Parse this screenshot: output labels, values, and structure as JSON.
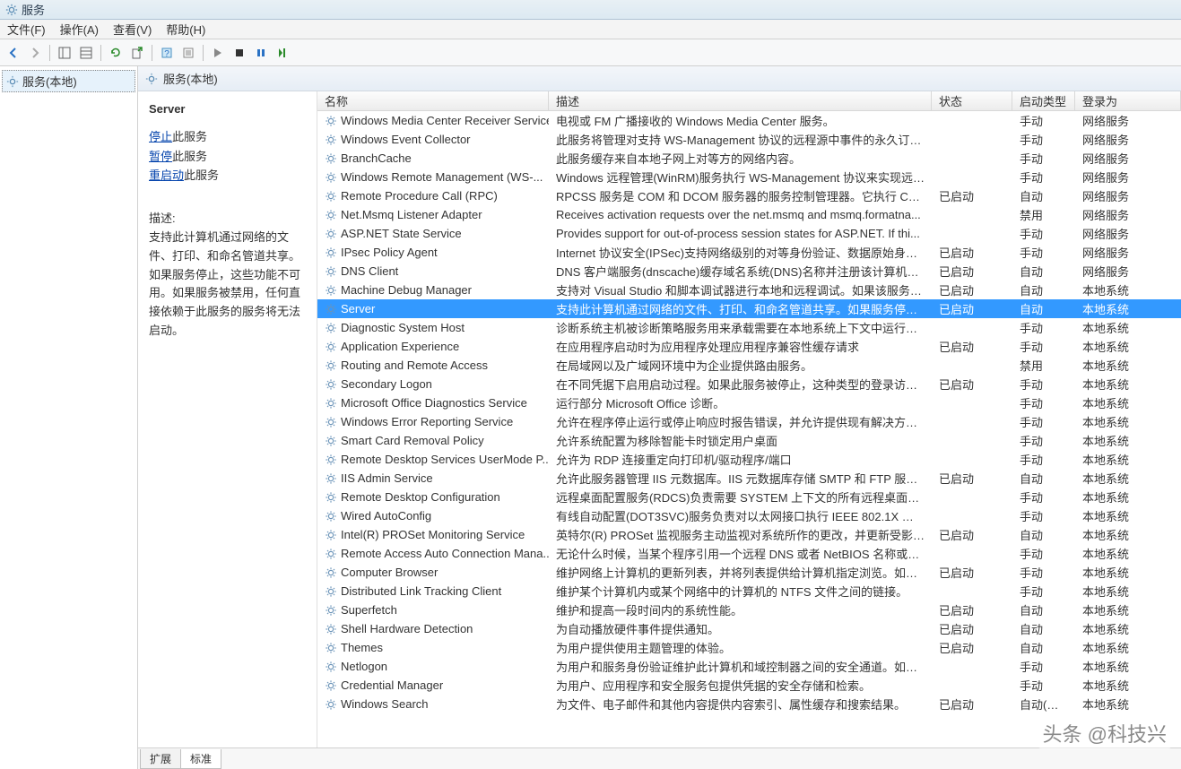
{
  "window_title": "服务",
  "menus": {
    "file": "文件(F)",
    "action": "操作(A)",
    "view": "查看(V)",
    "help": "帮助(H)"
  },
  "tree": {
    "root": "服务(本地)"
  },
  "content_header": "服务(本地)",
  "detail": {
    "title": "Server",
    "stop_link": "停止",
    "stop_suffix": "此服务",
    "pause_link": "暂停",
    "pause_suffix": "此服务",
    "restart_link": "重启动",
    "restart_suffix": "此服务",
    "desc_label": "描述:",
    "desc_text": "支持此计算机通过网络的文件、打印、和命名管道共享。如果服务停止，这些功能不可用。如果服务被禁用，任何直接依赖于此服务的服务将无法启动。"
  },
  "columns": {
    "name": "名称",
    "desc": "描述",
    "status": "状态",
    "start": "启动类型",
    "logon": "登录为"
  },
  "services": [
    {
      "name": "Windows Media Center Receiver Service",
      "desc": "电视或 FM 广播接收的 Windows Media Center 服务。",
      "status": "",
      "start": "手动",
      "logon": "网络服务",
      "sel": false
    },
    {
      "name": "Windows Event Collector",
      "desc": "此服务将管理对支持 WS-Management 协议的远程源中事件的永久订阅。...",
      "status": "",
      "start": "手动",
      "logon": "网络服务",
      "sel": false
    },
    {
      "name": "BranchCache",
      "desc": "此服务缓存来自本地子网上对等方的网络内容。",
      "status": "",
      "start": "手动",
      "logon": "网络服务",
      "sel": false
    },
    {
      "name": "Windows Remote Management (WS-...",
      "desc": "Windows 远程管理(WinRM)服务执行 WS-Management 协议来实现远程...",
      "status": "",
      "start": "手动",
      "logon": "网络服务",
      "sel": false
    },
    {
      "name": "Remote Procedure Call (RPC)",
      "desc": "RPCSS 服务是 COM 和 DCOM 服务器的服务控制管理器。它执行 COM 和...",
      "status": "已启动",
      "start": "自动",
      "logon": "网络服务",
      "sel": false
    },
    {
      "name": "Net.Msmq Listener Adapter",
      "desc": "Receives activation requests over the net.msmq and msmq.formatna...",
      "status": "",
      "start": "禁用",
      "logon": "网络服务",
      "sel": false
    },
    {
      "name": "ASP.NET State Service",
      "desc": "Provides support for out-of-process session states for ASP.NET. If thi...",
      "status": "",
      "start": "手动",
      "logon": "网络服务",
      "sel": false
    },
    {
      "name": "IPsec Policy Agent",
      "desc": "Internet 协议安全(IPSec)支持网络级别的对等身份验证、数据原始身份验证...",
      "status": "已启动",
      "start": "手动",
      "logon": "网络服务",
      "sel": false
    },
    {
      "name": "DNS Client",
      "desc": "DNS 客户端服务(dnscache)缓存域名系统(DNS)名称并注册该计算机的完整...",
      "status": "已启动",
      "start": "自动",
      "logon": "网络服务",
      "sel": false
    },
    {
      "name": "Machine Debug Manager",
      "desc": "支持对 Visual Studio 和脚本调试器进行本地和远程调试。如果该服务停...",
      "status": "已启动",
      "start": "自动",
      "logon": "本地系统",
      "sel": false
    },
    {
      "name": "Server",
      "desc": "支持此计算机通过网络的文件、打印、和命名管道共享。如果服务停止，这...",
      "status": "已启动",
      "start": "自动",
      "logon": "本地系统",
      "sel": true
    },
    {
      "name": "Diagnostic System Host",
      "desc": "诊断系统主机被诊断策略服务用来承载需要在本地系统上下文中运行的诊断...",
      "status": "",
      "start": "手动",
      "logon": "本地系统",
      "sel": false
    },
    {
      "name": "Application Experience",
      "desc": "在应用程序启动时为应用程序处理应用程序兼容性缓存请求",
      "status": "已启动",
      "start": "手动",
      "logon": "本地系统",
      "sel": false
    },
    {
      "name": "Routing and Remote Access",
      "desc": "在局域网以及广域网环境中为企业提供路由服务。",
      "status": "",
      "start": "禁用",
      "logon": "本地系统",
      "sel": false
    },
    {
      "name": "Secondary Logon",
      "desc": "在不同凭据下启用启动过程。如果此服务被停止，这种类型的登录访问将不...",
      "status": "已启动",
      "start": "手动",
      "logon": "本地系统",
      "sel": false
    },
    {
      "name": "Microsoft Office Diagnostics Service",
      "desc": "运行部分 Microsoft Office 诊断。",
      "status": "",
      "start": "手动",
      "logon": "本地系统",
      "sel": false
    },
    {
      "name": "Windows Error Reporting Service",
      "desc": "允许在程序停止运行或停止响应时报告错误，并允许提供现有解决方案。还...",
      "status": "",
      "start": "手动",
      "logon": "本地系统",
      "sel": false
    },
    {
      "name": "Smart Card Removal Policy",
      "desc": "允许系统配置为移除智能卡时锁定用户桌面",
      "status": "",
      "start": "手动",
      "logon": "本地系统",
      "sel": false
    },
    {
      "name": "Remote Desktop Services UserMode P...",
      "desc": "允许为 RDP 连接重定向打印机/驱动程序/端口",
      "status": "",
      "start": "手动",
      "logon": "本地系统",
      "sel": false
    },
    {
      "name": "IIS Admin Service",
      "desc": "允许此服务器管理 IIS 元数据库。IIS 元数据库存储 SMTP 和 FTP 服务的配...",
      "status": "已启动",
      "start": "自动",
      "logon": "本地系统",
      "sel": false
    },
    {
      "name": "Remote Desktop Configuration",
      "desc": "远程桌面配置服务(RDCS)负责需要 SYSTEM 上下文的所有远程桌面服务和远...",
      "status": "",
      "start": "手动",
      "logon": "本地系统",
      "sel": false
    },
    {
      "name": "Wired AutoConfig",
      "desc": "有线自动配置(DOT3SVC)服务负责对以太网接口执行 IEEE 802.1X 身份验证...",
      "status": "",
      "start": "手动",
      "logon": "本地系统",
      "sel": false
    },
    {
      "name": "Intel(R) PROSet Monitoring Service",
      "desc": "英特尔(R) PROSet 监视服务主动监视对系统所作的更改，并更新受影响的网...",
      "status": "已启动",
      "start": "自动",
      "logon": "本地系统",
      "sel": false
    },
    {
      "name": "Remote Access Auto Connection Mana...",
      "desc": "无论什么时候，当某个程序引用一个远程 DNS 或者 NetBIOS 名称或者地址...",
      "status": "",
      "start": "手动",
      "logon": "本地系统",
      "sel": false
    },
    {
      "name": "Computer Browser",
      "desc": "维护网络上计算机的更新列表，并将列表提供给计算机指定浏览。如果服务...",
      "status": "已启动",
      "start": "手动",
      "logon": "本地系统",
      "sel": false
    },
    {
      "name": "Distributed Link Tracking Client",
      "desc": "维护某个计算机内或某个网络中的计算机的 NTFS 文件之间的链接。",
      "status": "",
      "start": "手动",
      "logon": "本地系统",
      "sel": false
    },
    {
      "name": "Superfetch",
      "desc": "维护和提高一段时间内的系统性能。",
      "status": "已启动",
      "start": "自动",
      "logon": "本地系统",
      "sel": false
    },
    {
      "name": "Shell Hardware Detection",
      "desc": "为自动播放硬件事件提供通知。",
      "status": "已启动",
      "start": "自动",
      "logon": "本地系统",
      "sel": false
    },
    {
      "name": "Themes",
      "desc": "为用户提供使用主题管理的体验。",
      "status": "已启动",
      "start": "自动",
      "logon": "本地系统",
      "sel": false
    },
    {
      "name": "Netlogon",
      "desc": "为用户和服务身份验证维护此计算机和域控制器之间的安全通道。如果此服...",
      "status": "",
      "start": "手动",
      "logon": "本地系统",
      "sel": false
    },
    {
      "name": "Credential Manager",
      "desc": "为用户、应用程序和安全服务包提供凭据的安全存储和检索。",
      "status": "",
      "start": "手动",
      "logon": "本地系统",
      "sel": false
    },
    {
      "name": "Windows Search",
      "desc": "为文件、电子邮件和其他内容提供内容索引、属性缓存和搜索结果。",
      "status": "已启动",
      "start": "自动(延...",
      "logon": "本地系统",
      "sel": false
    }
  ],
  "tabs": {
    "extended": "扩展",
    "standard": "标准"
  },
  "watermark": "头条 @科技兴"
}
